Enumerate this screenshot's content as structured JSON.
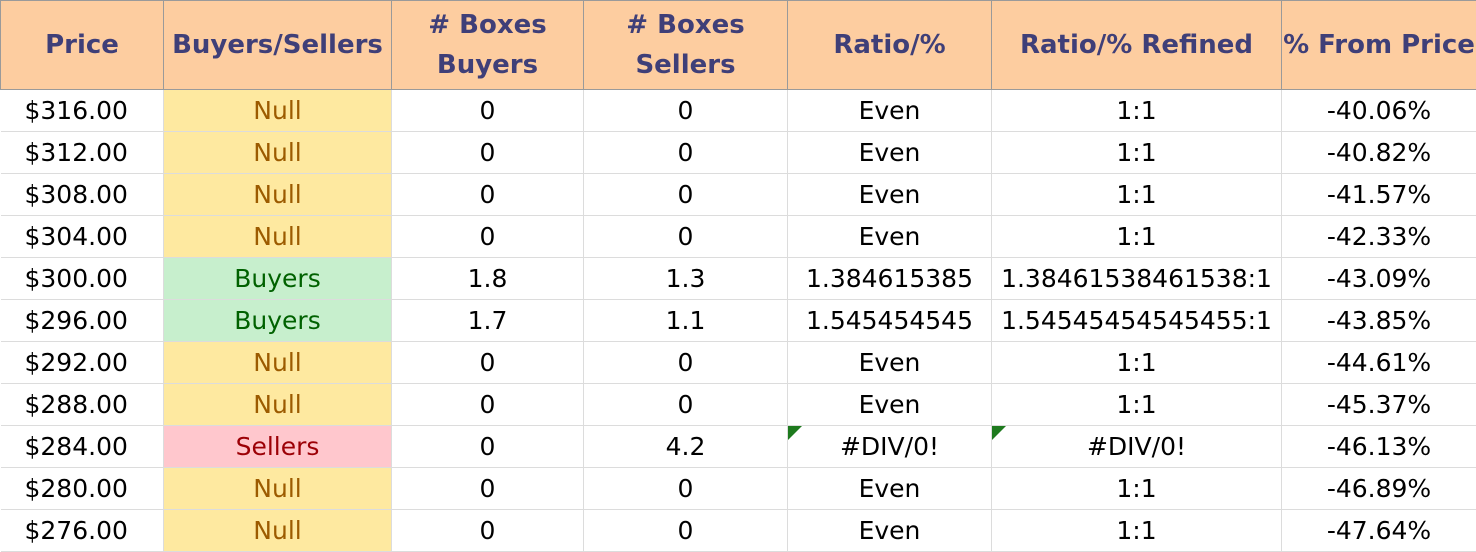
{
  "headers": [
    "Price",
    "Buyers/Sellers",
    "# Boxes Buyers",
    "# Boxes Sellers",
    "Ratio/%",
    "Ratio/% Refined",
    "% From Price"
  ],
  "status_colors": {
    "null_bg": "#fee9a0",
    "null_text": "#9c5b00",
    "buyers_bg": "#c7efcd",
    "buyers_text": "#006100",
    "sellers_bg": "#ffc7cd",
    "sellers_text": "#9c0006",
    "header_bg": "#fdcda0",
    "header_text": "#3f3f78"
  },
  "rows": [
    {
      "price": "$316.00",
      "status": "Null",
      "buyers": "0",
      "sellers": "0",
      "ratio": "Even",
      "refined": "1:1",
      "from_price": "-40.06%"
    },
    {
      "price": "$312.00",
      "status": "Null",
      "buyers": "0",
      "sellers": "0",
      "ratio": "Even",
      "refined": "1:1",
      "from_price": "-40.82%"
    },
    {
      "price": "$308.00",
      "status": "Null",
      "buyers": "0",
      "sellers": "0",
      "ratio": "Even",
      "refined": "1:1",
      "from_price": "-41.57%"
    },
    {
      "price": "$304.00",
      "status": "Null",
      "buyers": "0",
      "sellers": "0",
      "ratio": "Even",
      "refined": "1:1",
      "from_price": "-42.33%"
    },
    {
      "price": "$300.00",
      "status": "Buyers",
      "buyers": "1.8",
      "sellers": "1.3",
      "ratio": "1.384615385",
      "refined": "1.38461538461538:1",
      "from_price": "-43.09%"
    },
    {
      "price": "$296.00",
      "status": "Buyers",
      "buyers": "1.7",
      "sellers": "1.1",
      "ratio": "1.545454545",
      "refined": "1.54545454545455:1",
      "from_price": "-43.85%"
    },
    {
      "price": "$292.00",
      "status": "Null",
      "buyers": "0",
      "sellers": "0",
      "ratio": "Even",
      "refined": "1:1",
      "from_price": "-44.61%"
    },
    {
      "price": "$288.00",
      "status": "Null",
      "buyers": "0",
      "sellers": "0",
      "ratio": "Even",
      "refined": "1:1",
      "from_price": "-45.37%"
    },
    {
      "price": "$284.00",
      "status": "Sellers",
      "buyers": "0",
      "sellers": "4.2",
      "ratio": "#DIV/0!",
      "refined": "#DIV/0!",
      "from_price": "-46.13%",
      "error_flag": true
    },
    {
      "price": "$280.00",
      "status": "Null",
      "buyers": "0",
      "sellers": "0",
      "ratio": "Even",
      "refined": "1:1",
      "from_price": "-46.89%"
    },
    {
      "price": "$276.00",
      "status": "Null",
      "buyers": "0",
      "sellers": "0",
      "ratio": "Even",
      "refined": "1:1",
      "from_price": "-47.64%"
    }
  ]
}
